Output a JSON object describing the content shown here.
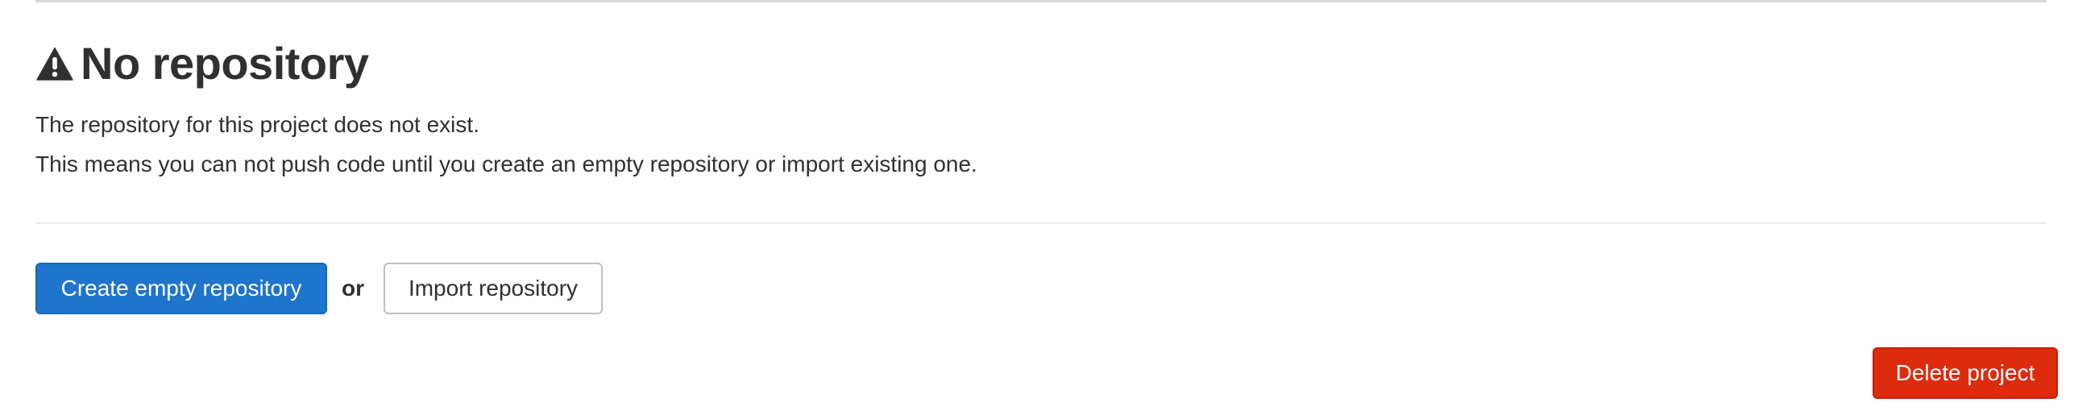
{
  "empty_state": {
    "title": "No repository",
    "icon": "warning-icon",
    "description_line_1": "The repository for this project does not exist.",
    "description_line_2": "This means you can not push code until you create an empty repository or import existing one."
  },
  "actions": {
    "create_label": "Create empty repository",
    "separator_text": "or",
    "import_label": "Import repository",
    "delete_label": "Delete project"
  },
  "colors": {
    "primary": "#1f75cb",
    "danger": "#dd2b0e",
    "text": "#303030"
  }
}
